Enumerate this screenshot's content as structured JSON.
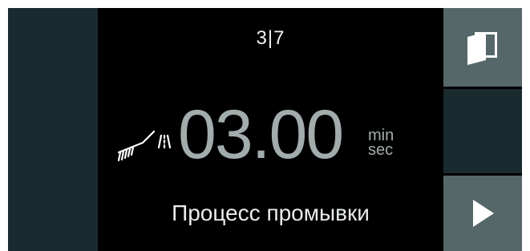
{
  "step_indicator": "3|7",
  "timer": {
    "value": "03.00",
    "unit_top": "min",
    "unit_bottom": "sec"
  },
  "process_label": "Процесс промывки",
  "icons": {
    "status": "rinse-brush-spray-icon",
    "door": "door-icon",
    "next": "play-arrow-icon"
  },
  "colors": {
    "screen_bg": "#000000",
    "side_panel": "#192b2f",
    "button_bg": "#56676a",
    "timer_text": "#a3acad",
    "primary_text": "#f2f4f4"
  }
}
